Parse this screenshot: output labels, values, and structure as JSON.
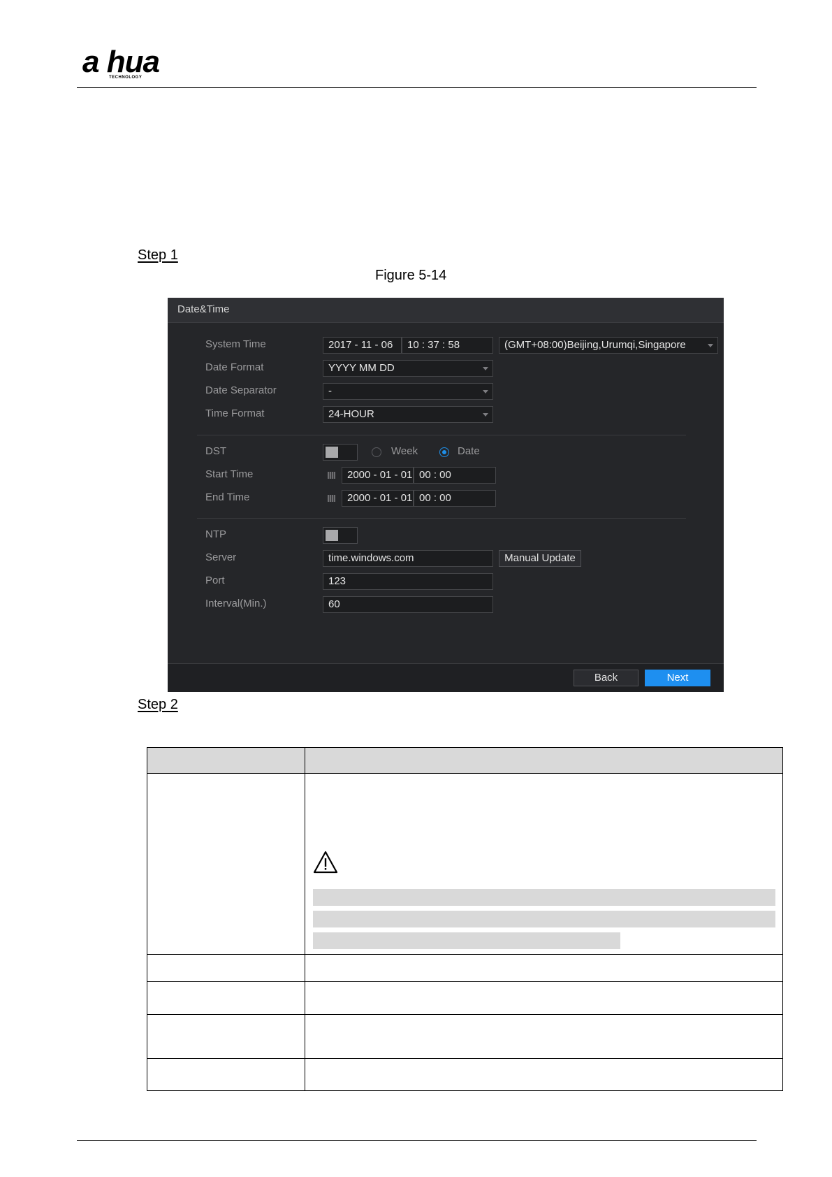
{
  "header": {
    "logo_text": "a hua",
    "logo_subtext": "TECHNOLOGY"
  },
  "steps": {
    "step1": "Step 1",
    "step2": "Step 2"
  },
  "figure_caption": "Figure 5-14",
  "dvr": {
    "title": "Date&Time",
    "labels": {
      "system_time": "System Time",
      "date_format": "Date Format",
      "date_separator": "Date Separator",
      "time_format": "Time Format",
      "dst": "DST",
      "start_time": "Start Time",
      "end_time": "End Time",
      "ntp": "NTP",
      "server": "Server",
      "port": "Port",
      "interval": "Interval(Min.)"
    },
    "system_date": "2017 - 11 - 06",
    "system_clock": "10 : 37 : 58",
    "timezone": "(GMT+08:00)Beijing,Urumqi,Singapore",
    "date_format": "YYYY MM DD",
    "date_separator": "-",
    "time_format": "24-HOUR",
    "dst_enabled": false,
    "dst_mode_options": [
      "Week",
      "Date"
    ],
    "dst_mode_selected": "Date",
    "start_date": "2000 - 01 - 01",
    "start_clock": "00 : 00",
    "end_date": "2000 - 01 - 01",
    "end_clock": "00 : 00",
    "ntp_enabled": false,
    "server": "time.windows.com",
    "manual_update": "Manual Update",
    "port": "123",
    "interval": "60",
    "back": "Back",
    "next": "Next"
  },
  "colors": {
    "panel_bg": "#252629",
    "accent": "#1e8ff0"
  }
}
